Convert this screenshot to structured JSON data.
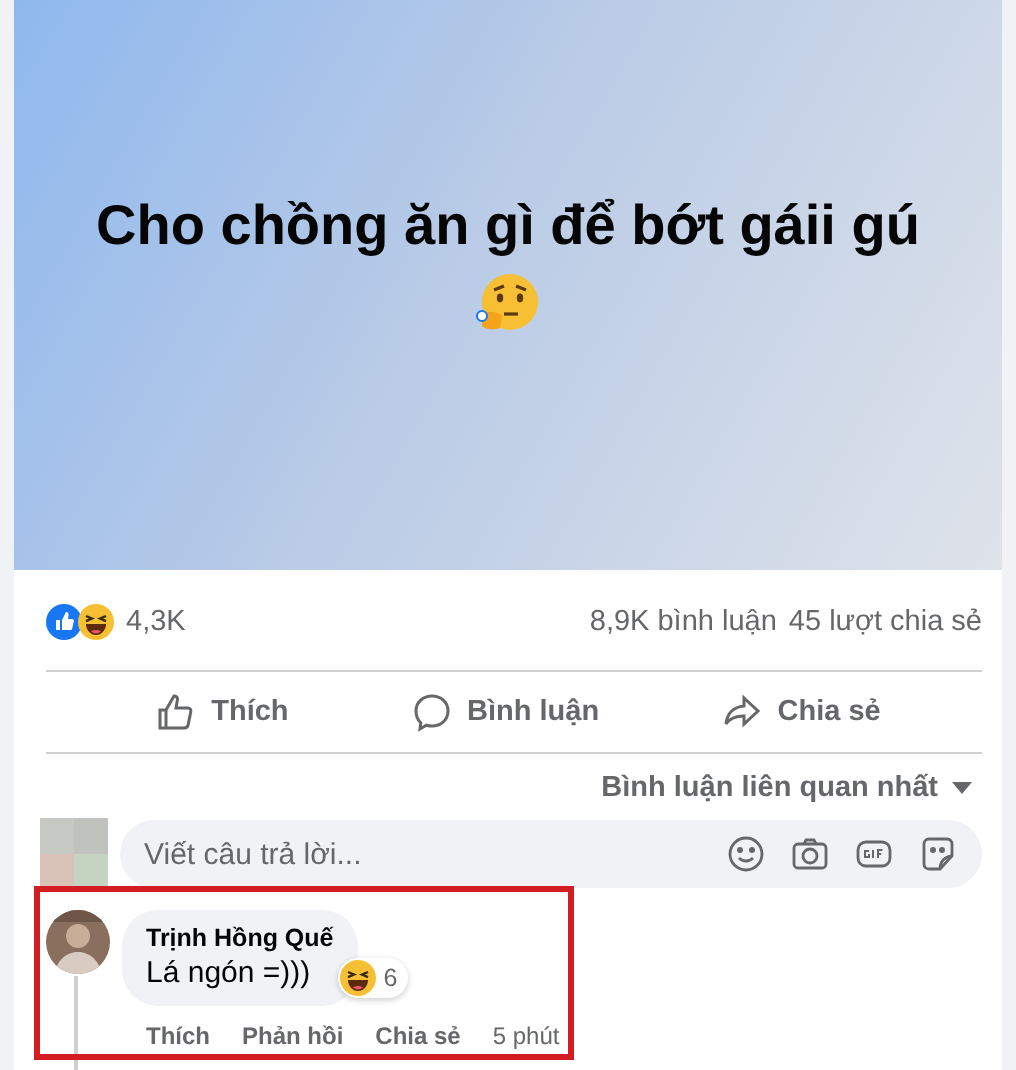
{
  "post": {
    "title": "Cho chồng ăn gì để bớt gáii gú",
    "reaction_count": "4,3K",
    "comment_count": "8,9K bình luận",
    "share_count": "45 lượt chia sẻ"
  },
  "actions": [
    {
      "kind": "like",
      "label": "Thích"
    },
    {
      "kind": "comment",
      "label": "Bình luận"
    },
    {
      "kind": "share",
      "label": "Chia sẻ"
    }
  ],
  "sort": {
    "label": "Bình luận liên quan nhất"
  },
  "reply_field": {
    "placeholder": "Viết câu trả lời..."
  },
  "comment": {
    "author": "Trịnh Hồng Quế",
    "text": "Lá ngón =)))",
    "reaction_count": "6",
    "actions": [
      "Thích",
      "Phản hồi",
      "Chia sẻ"
    ],
    "time": "5 phút"
  }
}
